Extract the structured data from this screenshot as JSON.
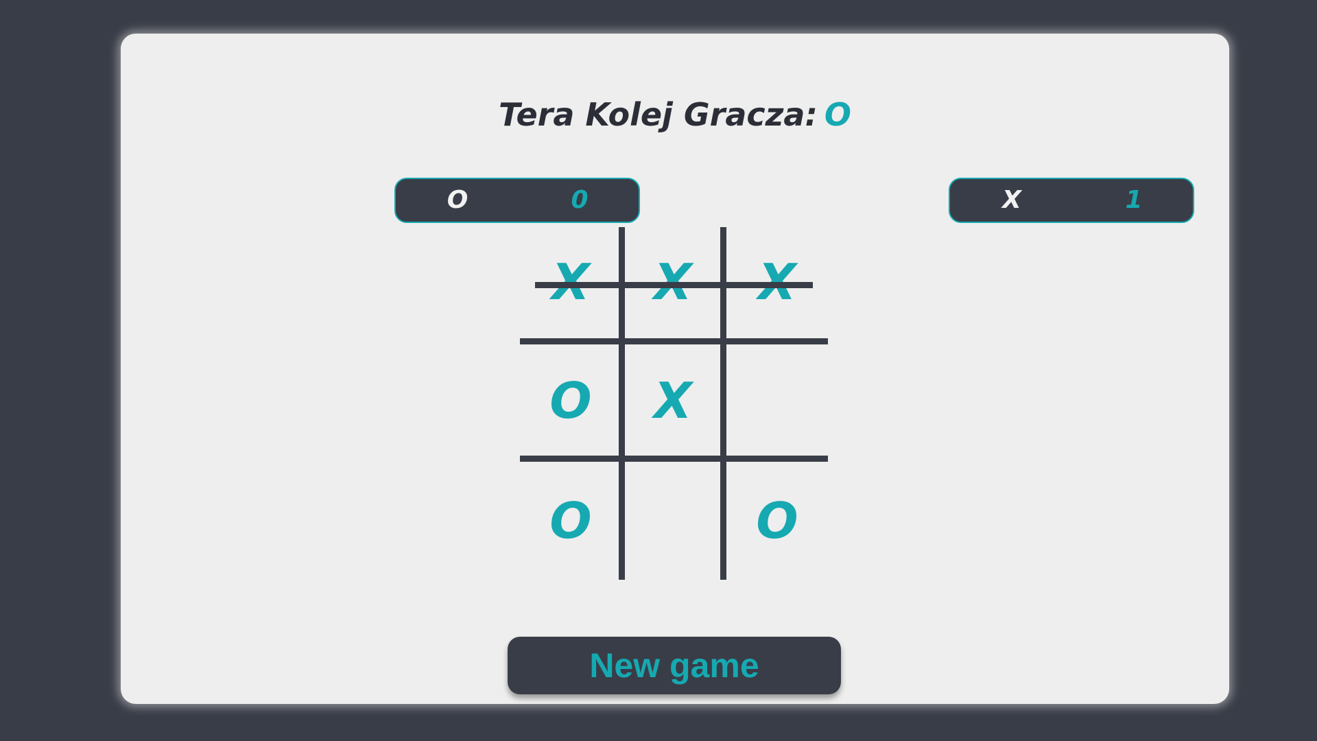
{
  "header": {
    "turn_label": "Tera Kolej Gracza:",
    "current_player": "O"
  },
  "scoreboard": {
    "left": {
      "mark": "O",
      "score": "0"
    },
    "right": {
      "mark": "X",
      "score": "1"
    }
  },
  "board": {
    "cells": [
      "X",
      "X",
      "X",
      "O",
      "X",
      "",
      "O",
      "",
      "O"
    ],
    "winning_row": "top"
  },
  "actions": {
    "new_game_label": "New game"
  },
  "colors": {
    "background": "#393d47",
    "card": "#eeeeee",
    "accent": "#16a9b1",
    "text": "#2b2e36"
  }
}
